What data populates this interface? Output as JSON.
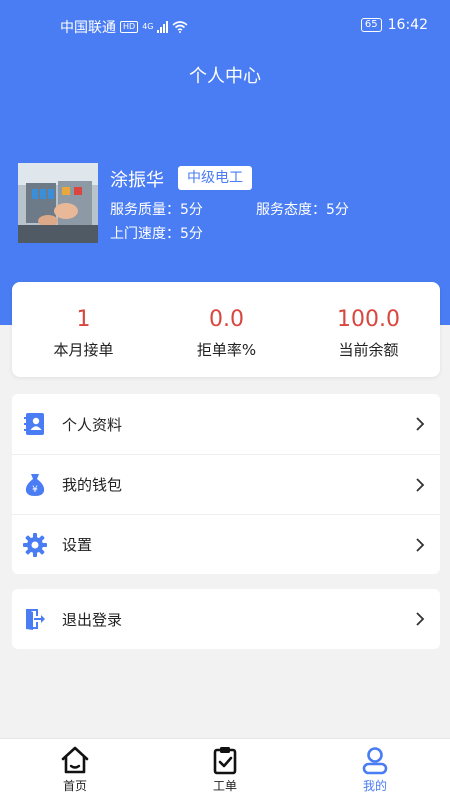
{
  "status_bar": {
    "carrier": "中国联通",
    "hd": "HD",
    "network": "4G",
    "battery": "65",
    "time": "16:42"
  },
  "header": {
    "title": "个人中心"
  },
  "profile": {
    "name": "涂振华",
    "level": "中级电工",
    "service_quality": "服务质量：5分",
    "service_attitude": "服务态度：5分",
    "visit_speed": "上门速度：5分"
  },
  "summary": [
    {
      "value": "1",
      "label": "本月接单"
    },
    {
      "value": "0.0",
      "label": "拒单率%"
    },
    {
      "value": "100.0",
      "label": "当前余额"
    }
  ],
  "menu": {
    "items": [
      {
        "label": "个人资料",
        "icon": "profile-card-icon"
      },
      {
        "label": "我的钱包",
        "icon": "money-bag-icon"
      },
      {
        "label": "设置",
        "icon": "gear-icon"
      }
    ],
    "logout": {
      "label": "退出登录",
      "icon": "logout-icon"
    }
  },
  "tabbar": {
    "items": [
      {
        "label": "首页",
        "icon": "home-icon"
      },
      {
        "label": "工单",
        "icon": "clipboard-check-icon"
      },
      {
        "label": "我的",
        "icon": "user-icon"
      }
    ],
    "active": "我的"
  },
  "colors": {
    "primary": "#4a7cf3",
    "value_red": "#d9463f",
    "background": "#f2f2f2"
  }
}
